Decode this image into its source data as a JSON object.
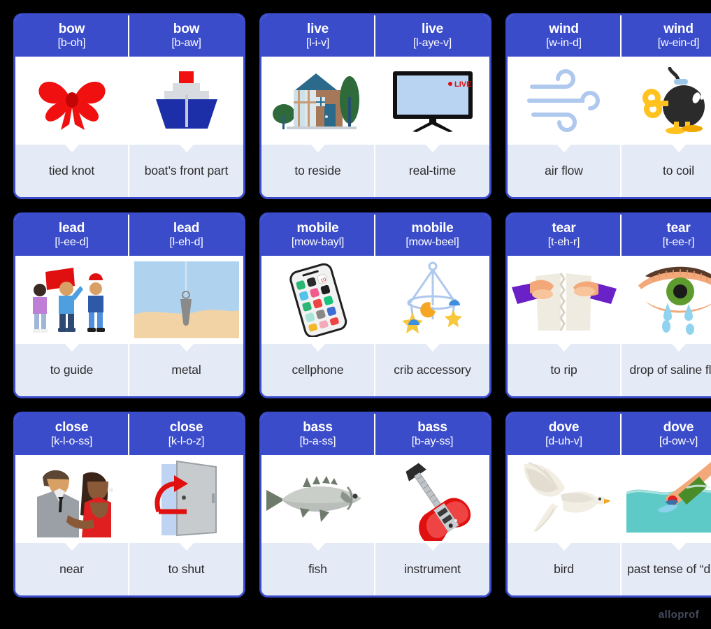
{
  "watermark": "alloprof",
  "theme": {
    "background": "#000000",
    "card_border": "#3B4CCB",
    "header_bg": "#3B4CCB",
    "header_text": "#FFFFFF",
    "definition_bg": "#E5EAF7",
    "definition_text": "#2B2B2B",
    "card_bg": "#FFFFFF"
  },
  "cards": [
    {
      "id": "bow",
      "left": {
        "word": "bow",
        "phonetic": "[b-oh]",
        "definition": "tied knot",
        "icon": "red-ribbon-bow-icon"
      },
      "right": {
        "word": "bow",
        "phonetic": "[b-aw]",
        "definition": "boat’s front part",
        "icon": "ship-bow-icon"
      }
    },
    {
      "id": "live",
      "left": {
        "word": "live",
        "phonetic": "[l-i-v]",
        "definition": "to reside",
        "icon": "house-icon"
      },
      "right": {
        "word": "live",
        "phonetic": "[l-aye-v]",
        "definition": "real-time",
        "icon": "television-live-icon"
      }
    },
    {
      "id": "wind",
      "left": {
        "word": "wind",
        "phonetic": "[w-in-d]",
        "definition": "air flow",
        "icon": "wind-gust-icon"
      },
      "right": {
        "word": "wind",
        "phonetic": "[w-ein-d]",
        "definition": "to coil",
        "icon": "wind-up-bomb-icon"
      }
    },
    {
      "id": "lead",
      "left": {
        "word": "lead",
        "phonetic": "[l-ee-d]",
        "definition": "to guide",
        "icon": "flag-leader-group-icon"
      },
      "right": {
        "word": "lead",
        "phonetic": "[l-eh-d]",
        "definition": "metal",
        "icon": "plumb-bob-weight-icon"
      }
    },
    {
      "id": "mobile",
      "left": {
        "word": "mobile",
        "phonetic": "[mow-bayl]",
        "definition": "cellphone",
        "icon": "smartphone-icon"
      },
      "right": {
        "word": "mobile",
        "phonetic": "[mow-beel]",
        "definition": "crib accessory",
        "icon": "crib-mobile-icon"
      }
    },
    {
      "id": "tear",
      "left": {
        "word": "tear",
        "phonetic": "[t-eh-r]",
        "definition": "to rip",
        "icon": "hands-tearing-paper-icon"
      },
      "right": {
        "word": "tear",
        "phonetic": "[t-ee-r]",
        "definition": "drop of saline fluid",
        "icon": "crying-eye-icon"
      }
    },
    {
      "id": "close",
      "left": {
        "word": "close",
        "phonetic": "[k-l-o-ss]",
        "definition": "near",
        "icon": "couple-embracing-icon"
      },
      "right": {
        "word": "close",
        "phonetic": "[k-l-o-z]",
        "definition": "to shut",
        "icon": "closing-door-arrow-icon"
      }
    },
    {
      "id": "bass",
      "left": {
        "word": "bass",
        "phonetic": "[b-a-ss]",
        "definition": "fish",
        "icon": "bass-fish-icon"
      },
      "right": {
        "word": "bass",
        "phonetic": "[b-ay-ss]",
        "definition": "instrument",
        "icon": "electric-guitar-icon"
      }
    },
    {
      "id": "dove",
      "left": {
        "word": "dove",
        "phonetic": "[d-uh-v]",
        "definition": "bird",
        "icon": "dove-bird-icon"
      },
      "right": {
        "word": "dove",
        "phonetic": "[d-ow-v]",
        "definition": "past tense of “dive”",
        "icon": "diver-into-water-icon"
      }
    }
  ]
}
